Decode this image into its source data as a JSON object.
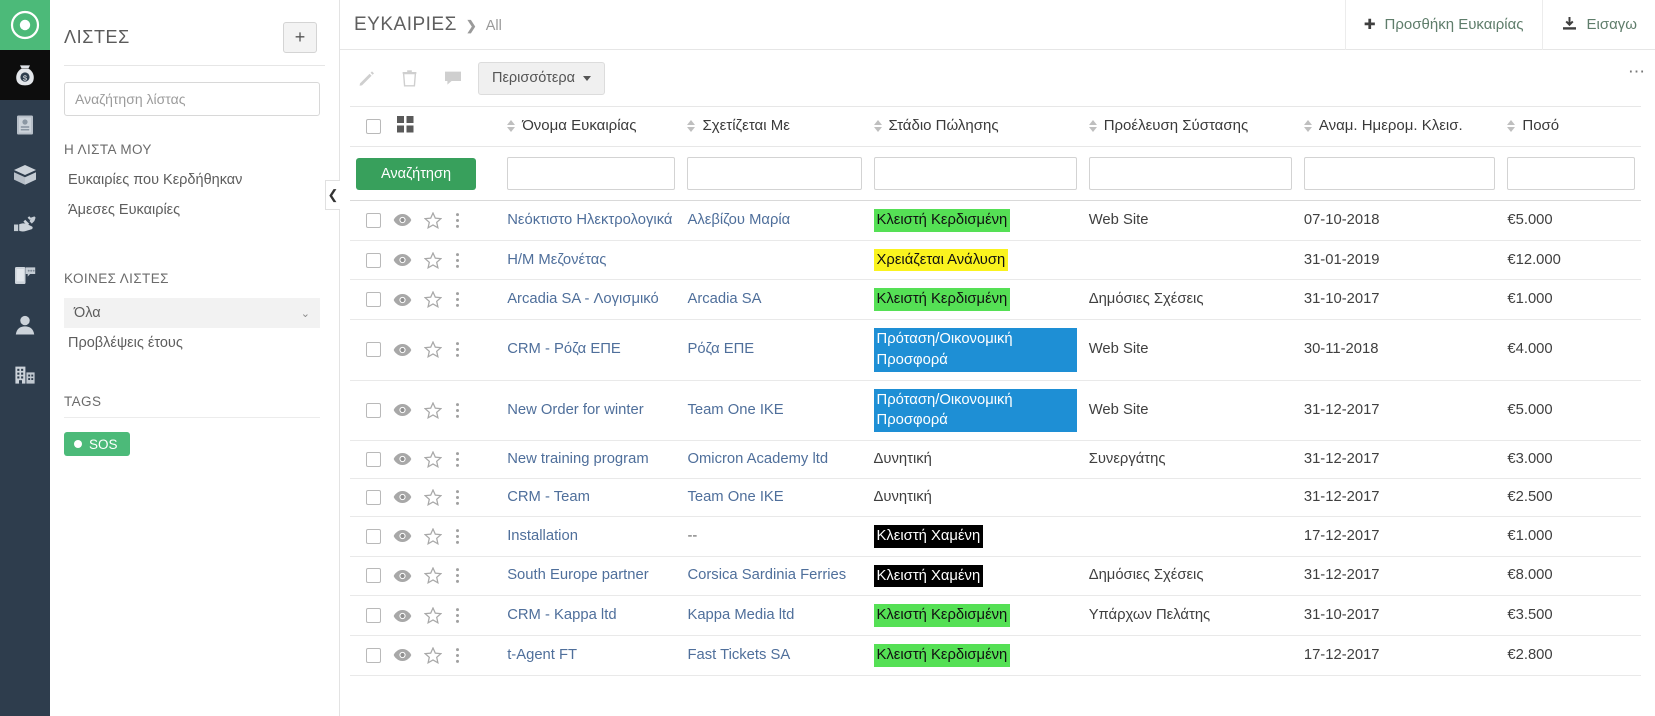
{
  "brand": {
    "accent_green": "#4cba79",
    "rail_bg": "#2e3d4d",
    "search_button_green": "#38a05c",
    "link_blue": "#4f6f9b"
  },
  "rail": {
    "logo_icon": "target-circle-logo-icon",
    "items": [
      {
        "icon": "money-bag-icon",
        "name": "rail-item-opportunities",
        "active": true
      },
      {
        "icon": "contact-card-icon",
        "name": "rail-item-contacts",
        "active": false
      },
      {
        "icon": "package-box-icon",
        "name": "rail-item-products",
        "active": false
      },
      {
        "icon": "service-hand-wrench-icon",
        "name": "rail-item-services",
        "active": false
      },
      {
        "icon": "mobile-chat-icon",
        "name": "rail-item-campaigns",
        "active": false
      },
      {
        "icon": "person-icon",
        "name": "rail-item-persons",
        "active": false
      },
      {
        "icon": "building-icon",
        "name": "rail-item-companies",
        "active": false
      }
    ]
  },
  "header": {
    "breadcrumb_main": "ΕΥΚΑΙΡΙΕΣ",
    "breadcrumb_sep": "❯",
    "breadcrumb_sub": "All",
    "buttons": [
      {
        "icon": "plus-icon",
        "label": "Προσθήκη Ευκαιρίας",
        "name": "add-opportunity-button"
      },
      {
        "icon": "import-download-icon",
        "label": "Εισαγω",
        "name": "import-button"
      }
    ]
  },
  "sidebar": {
    "title": "ΛΙΣΤΕΣ",
    "add_button_icon": "plus-icon",
    "search": {
      "placeholder": "Αναζήτηση λίστας",
      "value": ""
    },
    "my_lists_heading": "Η ΛΙΣΤΑ ΜΟΥ",
    "my_lists": [
      {
        "label": "Ευκαιρίες που Κερδήθηκαν"
      },
      {
        "label": "Άμεσες Ευκαιρίες"
      }
    ],
    "shared_lists_heading": "ΚΟΙΝΕΣ ΛΙΣΤΕΣ",
    "shared_selected": "Όλα",
    "shared_lists": [
      {
        "label": "Προβλέψεις έτους"
      }
    ],
    "tags_heading": "TAGS",
    "tags": [
      {
        "label": "SOS",
        "color": "#4cba79"
      }
    ],
    "collapse_icon": "chevron-left-icon"
  },
  "toolbar": {
    "icons": [
      {
        "icon": "pencil-edit-icon",
        "name": "edit-button"
      },
      {
        "icon": "trash-delete-icon",
        "name": "delete-button"
      },
      {
        "icon": "comment-bubble-icon",
        "name": "comment-button"
      }
    ],
    "more_label": "Περισσότερα",
    "right_icon": "settings-columns-icon"
  },
  "table": {
    "select_all_icon": "select-all-checkbox",
    "grid_view_icon": "grid-view-icon",
    "columns": [
      {
        "key": "actions",
        "label": "",
        "sortable": false
      },
      {
        "key": "name",
        "label": "Όνομα Ευκαιρίας",
        "sortable": true
      },
      {
        "key": "related",
        "label": "Σχετίζεται Με",
        "sortable": true
      },
      {
        "key": "stage",
        "label": "Στάδιο Πώλησης",
        "sortable": true
      },
      {
        "key": "source",
        "label": "Προέλευση Σύστασης",
        "sortable": true
      },
      {
        "key": "close_date",
        "label": "Αναμ. Ημερομ. Κλεισ.",
        "sortable": true
      },
      {
        "key": "amount",
        "label": "Ποσό",
        "sortable": true
      }
    ],
    "filter_row": {
      "search_label": "Αναζήτηση",
      "name_value": "",
      "related_value": "",
      "stage_value": "",
      "source_value": "",
      "close_date_value": "",
      "amount_value": ""
    },
    "row_icons": [
      "checkbox",
      "eye-preview-icon",
      "star-favorite-icon",
      "vertical-dots-menu-icon"
    ],
    "rows": [
      {
        "name": "Νεόκτιστο Ηλεκτρολογικά",
        "related": "Αλεβίζου Μαρία",
        "stage": "Κλειστή Κερδισμένη",
        "stage_bg": "#55e055",
        "stage_fg": "#111111",
        "source": "Web Site",
        "close_date": "07-10-2018",
        "amount": "€5.000"
      },
      {
        "name": "Η/Μ Μεζονέτας",
        "related": "",
        "stage": "Χρειάζεται Ανάλυση",
        "stage_bg": "#faf31e",
        "stage_fg": "#111111",
        "source": "",
        "close_date": "31-01-2019",
        "amount": "€12.000"
      },
      {
        "name": "Arcadia SA - Λογισμικό",
        "related": "Arcadia SA",
        "stage": "Κλειστή Κερδισμένη",
        "stage_bg": "#55e055",
        "stage_fg": "#111111",
        "source": "Δημόσιες Σχέσεις",
        "close_date": "31-10-2017",
        "amount": "€1.000"
      },
      {
        "name": "CRM - Ρόζα ΕΠΕ",
        "related": "Ρόζα ΕΠΕ",
        "stage": "Πρόταση/Οικονομική Προσφορά",
        "stage_bg": "#1e8fd5",
        "stage_fg": "#ffffff",
        "source": "Web Site",
        "close_date": "30-11-2018",
        "amount": "€4.000"
      },
      {
        "name": "New Order for winter",
        "related": "Team One IKE",
        "stage": "Πρόταση/Οικονομική Προσφορά",
        "stage_bg": "#1e8fd5",
        "stage_fg": "#ffffff",
        "source": "Web Site",
        "close_date": "31-12-2017",
        "amount": "€5.000"
      },
      {
        "name": "New training program",
        "related": "Omicron Academy ltd",
        "stage": "Δυνητική",
        "stage_bg": "transparent",
        "stage_fg": "#3f3f3f",
        "source": "Συνεργάτης",
        "close_date": "31-12-2017",
        "amount": "€3.000"
      },
      {
        "name": "CRM - Team",
        "related": "Team One IKE",
        "stage": "Δυνητική",
        "stage_bg": "transparent",
        "stage_fg": "#3f3f3f",
        "source": "",
        "close_date": "31-12-2017",
        "amount": "€2.500"
      },
      {
        "name": "Installation",
        "related": "--",
        "stage": "Κλειστή Χαμένη",
        "stage_bg": "#000000",
        "stage_fg": "#ffffff",
        "source": "",
        "close_date": "17-12-2017",
        "amount": "€1.000"
      },
      {
        "name": "South Europe partner",
        "related": "Corsica Sardinia Ferries",
        "stage": "Κλειστή Χαμένη",
        "stage_bg": "#000000",
        "stage_fg": "#ffffff",
        "source": "Δημόσιες Σχέσεις",
        "close_date": "31-12-2017",
        "amount": "€8.000"
      },
      {
        "name": "CRM - Kappa ltd",
        "related": "Kappa Media ltd",
        "stage": "Κλειστή Κερδισμένη",
        "stage_bg": "#55e055",
        "stage_fg": "#111111",
        "source": "Υπάρχων Πελάτης",
        "close_date": "31-10-2017",
        "amount": "€3.500"
      },
      {
        "name": "t-Agent FT",
        "related": "Fast Tickets SA",
        "stage": "Κλειστή Κερδισμένη",
        "stage_bg": "#55e055",
        "stage_fg": "#111111",
        "source": "",
        "close_date": "17-12-2017",
        "amount": "€2.800"
      }
    ]
  }
}
